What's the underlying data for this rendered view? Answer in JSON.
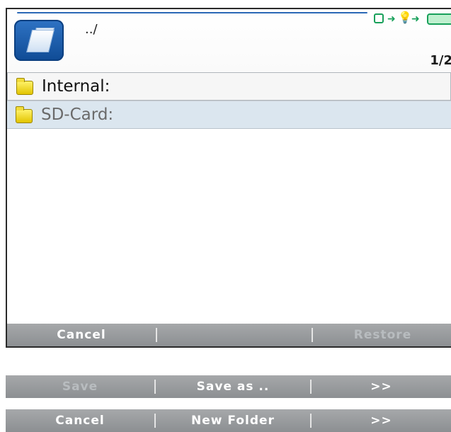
{
  "header": {
    "path": "../",
    "page_counter": "1/2",
    "icons": [
      "file-manager-icon",
      "screen-status-icon",
      "transfer-arrow-icon",
      "lightbulb-icon",
      "transfer-arrow-icon",
      "battery-icon"
    ]
  },
  "list": {
    "items": [
      {
        "label": "Internal:",
        "icon": "folder-icon",
        "selected": true
      },
      {
        "label": "SD-Card:",
        "icon": "folder-icon",
        "selected": false
      }
    ]
  },
  "softbar": {
    "left": "Cancel",
    "middle": "",
    "right": "Restore"
  },
  "bar1": {
    "left": "Save",
    "middle": "Save as ..",
    "right": ">>"
  },
  "bar2": {
    "left": "Cancel",
    "middle": "New Folder",
    "right": ">>"
  },
  "colors": {
    "accent": "#2a68b6",
    "softbar": "#9a9da0",
    "selected_row": "#f6f6f6",
    "alt_row": "#dbe6ef"
  }
}
